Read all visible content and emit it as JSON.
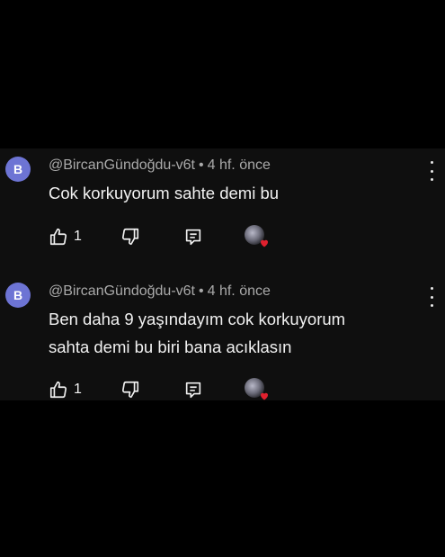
{
  "comments": [
    {
      "avatar_letter": "B",
      "author": "@BircanGündoğdu-v6t",
      "separator": "•",
      "time": "4 hf. önce",
      "text_lines": [
        "Cok korkuyorum sahte demi bu"
      ],
      "like_count": "1"
    },
    {
      "avatar_letter": "B",
      "author": "@BircanGündoğdu-v6t",
      "separator": "•",
      "time": "4 hf. önce",
      "text_lines": [
        "Ben daha 9 yaşındayım cok korkuyorum",
        "sahta demi bu biri bana acıklasın"
      ],
      "like_count": "1"
    }
  ],
  "icons": {
    "more": "more-vert-icon",
    "like": "thumbs-up-icon",
    "dislike": "thumbs-down-icon",
    "reply": "reply-icon",
    "creator_heart": "creator-heart-icon"
  },
  "colors": {
    "background": "#000000",
    "panel": "#0f0f0f",
    "avatar": "#6d74d4",
    "text": "#f1f1f1",
    "meta": "#aaaaaa",
    "heart": "#e0202e"
  }
}
